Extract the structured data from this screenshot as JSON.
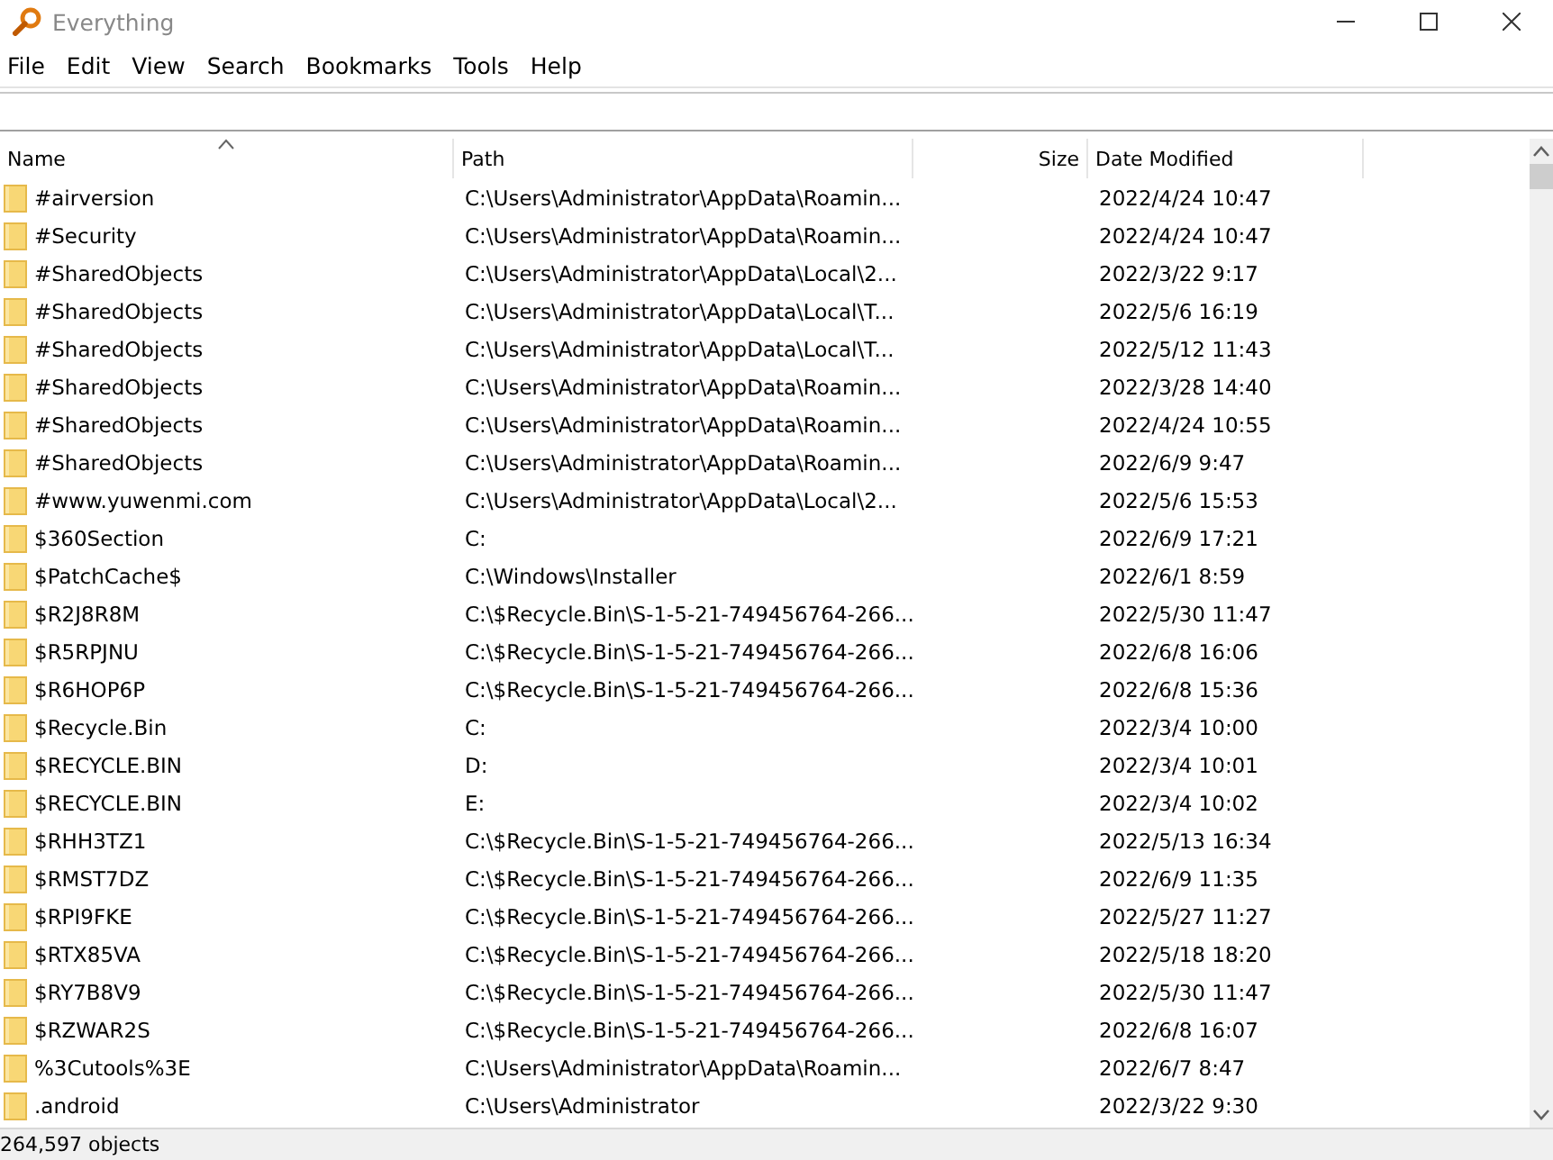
{
  "window": {
    "title": "Everything"
  },
  "menu": [
    "File",
    "Edit",
    "View",
    "Search",
    "Bookmarks",
    "Tools",
    "Help"
  ],
  "table": {
    "columns": [
      {
        "label": "Name",
        "sorted": true,
        "kind": "text"
      },
      {
        "label": "Path",
        "sorted": false,
        "kind": "text"
      },
      {
        "label": "Size",
        "sorted": false,
        "kind": "number"
      },
      {
        "label": "Date Modified",
        "sorted": false,
        "kind": "text"
      }
    ],
    "rows": [
      {
        "name": "#airversion",
        "path": "C:\\Users\\Administrator\\AppData\\Roamin...",
        "date": "2022/4/24 10:47"
      },
      {
        "name": "#Security",
        "path": "C:\\Users\\Administrator\\AppData\\Roamin...",
        "date": "2022/4/24 10:47"
      },
      {
        "name": "#SharedObjects",
        "path": "C:\\Users\\Administrator\\AppData\\Local\\2...",
        "date": "2022/3/22 9:17"
      },
      {
        "name": "#SharedObjects",
        "path": "C:\\Users\\Administrator\\AppData\\Local\\T...",
        "date": "2022/5/6 16:19"
      },
      {
        "name": "#SharedObjects",
        "path": "C:\\Users\\Administrator\\AppData\\Local\\T...",
        "date": "2022/5/12 11:43"
      },
      {
        "name": "#SharedObjects",
        "path": "C:\\Users\\Administrator\\AppData\\Roamin...",
        "date": "2022/3/28 14:40"
      },
      {
        "name": "#SharedObjects",
        "path": "C:\\Users\\Administrator\\AppData\\Roamin...",
        "date": "2022/4/24 10:55"
      },
      {
        "name": "#SharedObjects",
        "path": "C:\\Users\\Administrator\\AppData\\Roamin...",
        "date": "2022/6/9 9:47"
      },
      {
        "name": "#www.yuwenmi.com",
        "path": "C:\\Users\\Administrator\\AppData\\Local\\2...",
        "date": "2022/5/6 15:53"
      },
      {
        "name": "$360Section",
        "path": "C:",
        "date": "2022/6/9 17:21"
      },
      {
        "name": "$PatchCache$",
        "path": "C:\\Windows\\Installer",
        "date": "2022/6/1 8:59"
      },
      {
        "name": "$R2J8R8M",
        "path": "C:\\$Recycle.Bin\\S-1-5-21-749456764-266...",
        "date": "2022/5/30 11:47"
      },
      {
        "name": "$R5RPJNU",
        "path": "C:\\$Recycle.Bin\\S-1-5-21-749456764-266...",
        "date": "2022/6/8 16:06"
      },
      {
        "name": "$R6HOP6P",
        "path": "C:\\$Recycle.Bin\\S-1-5-21-749456764-266...",
        "date": "2022/6/8 15:36"
      },
      {
        "name": "$Recycle.Bin",
        "path": "C:",
        "date": "2022/3/4 10:00"
      },
      {
        "name": "$RECYCLE.BIN",
        "path": "D:",
        "date": "2022/3/4 10:01"
      },
      {
        "name": "$RECYCLE.BIN",
        "path": "E:",
        "date": "2022/3/4 10:02"
      },
      {
        "name": "$RHH3TZ1",
        "path": "C:\\$Recycle.Bin\\S-1-5-21-749456764-266...",
        "date": "2022/5/13 16:34"
      },
      {
        "name": "$RMST7DZ",
        "path": "C:\\$Recycle.Bin\\S-1-5-21-749456764-266...",
        "date": "2022/6/9 11:35"
      },
      {
        "name": "$RPI9FKE",
        "path": "C:\\$Recycle.Bin\\S-1-5-21-749456764-266...",
        "date": "2022/5/27 11:27"
      },
      {
        "name": "$RTX85VA",
        "path": "C:\\$Recycle.Bin\\S-1-5-21-749456764-266...",
        "date": "2022/5/18 18:20"
      },
      {
        "name": "$RY7B8V9",
        "path": "C:\\$Recycle.Bin\\S-1-5-21-749456764-266...",
        "date": "2022/5/30 11:47"
      },
      {
        "name": "$RZWAR2S",
        "path": "C:\\$Recycle.Bin\\S-1-5-21-749456764-266...",
        "date": "2022/6/8 16:07"
      },
      {
        "name": "%3Cutools%3E",
        "path": "C:\\Users\\Administrator\\AppData\\Roamin...",
        "date": "2022/6/7 8:47"
      },
      {
        "name": ".android",
        "path": "C:\\Users\\Administrator",
        "date": "2022/3/22 9:30"
      }
    ]
  },
  "status_bar": {
    "text": "264,597 objects"
  }
}
